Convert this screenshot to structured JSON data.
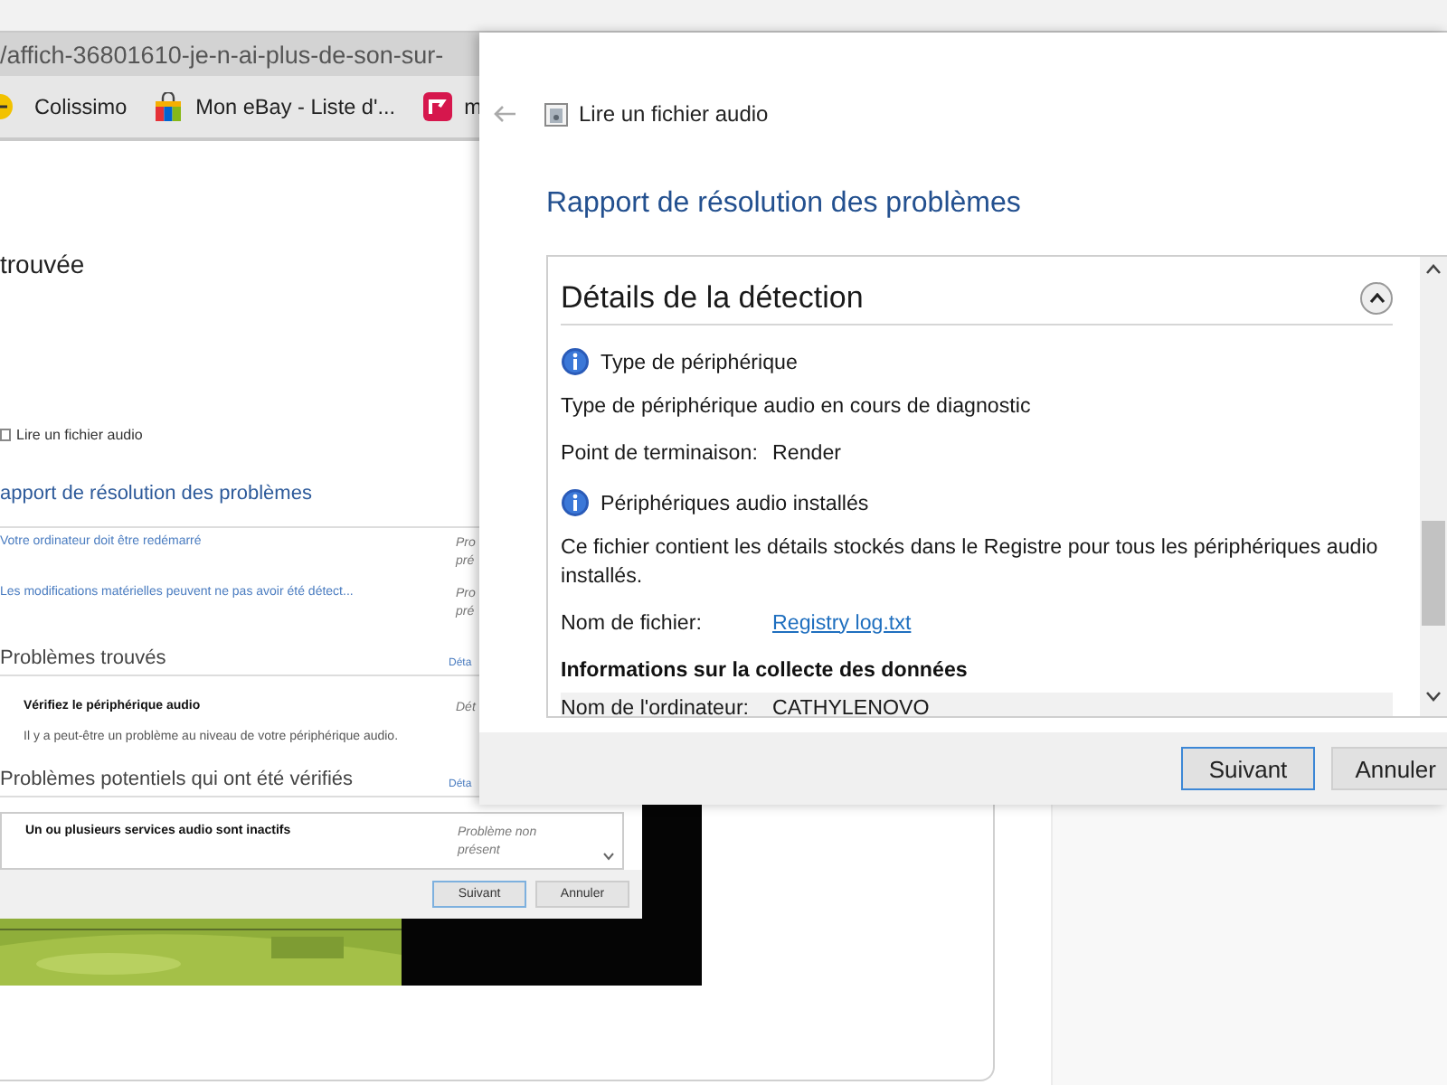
{
  "browser": {
    "url": "/affich-36801610-je-n-ai-plus-de-son-sur-",
    "bookmarks": [
      {
        "label": "Colissimo",
        "kind": "ball"
      },
      {
        "label": "Mon eBay - Liste d'...",
        "kind": "bag"
      },
      {
        "label": "m",
        "kind": "tile"
      }
    ]
  },
  "post_image": {
    "heading": "trouvée",
    "task_title": "Lire un fichier audio",
    "report_title": "apport de résolution des problèmes",
    "results": [
      {
        "text": "Votre ordinateur doit être redémarré",
        "status_lines": [
          "Pro",
          "pré"
        ]
      },
      {
        "text": "Les modifications matérielles peuvent ne pas avoir été détect...",
        "status_lines": [
          "Pro",
          "pré"
        ]
      }
    ],
    "groups": [
      {
        "title": "Problèmes trouvés",
        "details_link": "Déta",
        "items": [
          {
            "title": "Vérifiez le périphérique audio",
            "status_lines": [
              "Dét"
            ],
            "description": "Il y a peut-être un problème au niveau de votre périphérique audio.",
            "boxed": false
          }
        ]
      },
      {
        "title": "Problèmes potentiels qui ont été vérifiés",
        "details_link": "Déta",
        "items": [
          {
            "title": "Un ou plusieurs services audio sont inactifs",
            "status_lines": [
              "Problème non",
              "présent"
            ],
            "boxed": true
          }
        ]
      }
    ],
    "buttons": [
      {
        "label": "Suivant",
        "default": true
      },
      {
        "label": "Annuler",
        "default": false
      }
    ]
  },
  "dialog": {
    "task_title": "Lire un fichier audio",
    "report_title": "Rapport de résolution des problèmes",
    "section": {
      "title": "Détails de la détection",
      "expanded": true,
      "blocks": [
        {
          "kind": "info",
          "text": "Type de périphérique"
        },
        {
          "kind": "text",
          "text": "Type de périphérique audio en cours de diagnostic"
        },
        {
          "kind": "field",
          "label": "Point de terminaison:",
          "value": "Render"
        },
        {
          "kind": "info",
          "text": "Périphériques audio installés"
        },
        {
          "kind": "text",
          "text": "Ce fichier contient les détails stockés dans le Registre pour tous les périphériques audio installés."
        },
        {
          "kind": "link_field",
          "label": "Nom de fichier:",
          "value": "Registry log.txt"
        },
        {
          "kind": "heading",
          "text": "Informations sur la collecte des données"
        },
        {
          "kind": "shaded_field",
          "label": "Nom de l'ordinateur:",
          "value": "CATHYLENOVO"
        }
      ]
    },
    "buttons": [
      {
        "label": "Suivant",
        "default": true
      },
      {
        "label": "Annuler",
        "default": false
      }
    ]
  }
}
